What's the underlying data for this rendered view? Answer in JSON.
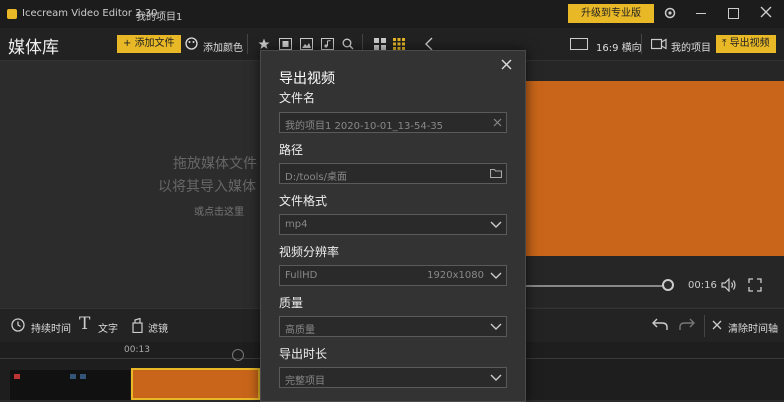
{
  "titlebar": {
    "app_name": "Icecream Video Editor 2.30",
    "project_name": "我的项目1",
    "upgrade_label": "升级到专业版"
  },
  "toolbar": {
    "library_title": "媒体库",
    "add_file_label": "添加文件",
    "add_color_label": "添加颜色",
    "ratio_label": "16:9 横向",
    "my_projects_label": "我的项目",
    "export_label": "导出视频"
  },
  "library": {
    "hint_line1": "拖放媒体文件",
    "hint_line2": "以将其导入媒体",
    "hint_line3": "或点击这里"
  },
  "preview": {
    "time": "00:16"
  },
  "tools": {
    "duration_label": "持续时间",
    "text_label": "文字",
    "filter_label": "滤镜",
    "clear_timeline_label": "清除时间轴"
  },
  "timeline": {
    "tick_label": "00:13"
  },
  "dialog": {
    "title": "导出视频",
    "filename_label": "文件名",
    "filename_value": "我的项目1 2020-10-01_13-54-35",
    "path_label": "路径",
    "path_value": "D:/tools/桌面",
    "format_label": "文件格式",
    "format_value": "mp4",
    "resolution_label": "视频分辨率",
    "resolution_value": "FullHD",
    "resolution_detail": "1920x1080",
    "quality_label": "质量",
    "quality_value": "高质量",
    "duration_label": "导出时长",
    "duration_value": "完整项目"
  },
  "colors": {
    "accent": "#e8b826",
    "video": "#c8651a"
  }
}
